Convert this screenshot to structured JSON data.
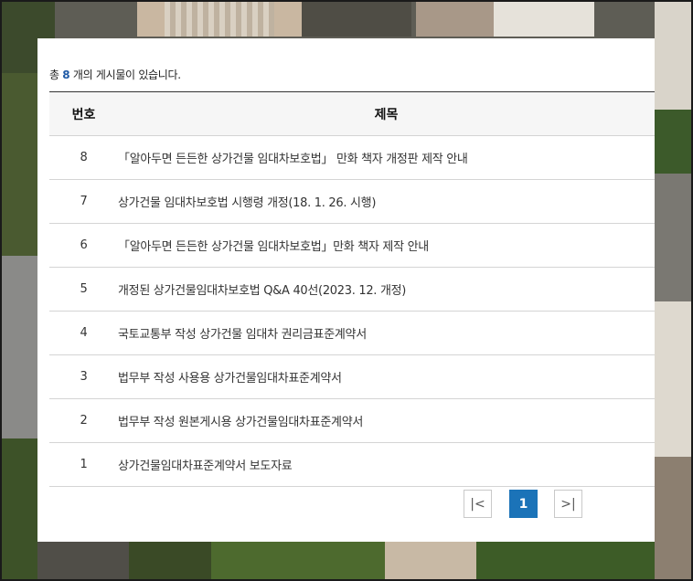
{
  "board": {
    "count_prefix": "총",
    "count": "8",
    "count_suffix": "개의 게시물이 있습니다."
  },
  "table": {
    "headers": [
      "번호",
      "제목"
    ],
    "rows": [
      {
        "num": "8",
        "title": "「알아두면 든든한 상가건물 임대차보호법」 만화 책자 개정판 제작 안내"
      },
      {
        "num": "7",
        "title": "상가건물 임대차보호법 시행령 개정(18. 1. 26. 시행)"
      },
      {
        "num": "6",
        "title": "「알아두면 든든한 상가건물 임대차보호법」만화 책자 제작 안내"
      },
      {
        "num": "5",
        "title": "개정된 상가건물임대차보호법 Q&A 40선(2023. 12. 개정)"
      },
      {
        "num": "4",
        "title": "국토교통부 작성 상가건물 임대차 권리금표준계약서"
      },
      {
        "num": "3",
        "title": "법무부 작성 사용용 상가건물임대차표준계약서"
      },
      {
        "num": "2",
        "title": "법무부 작성 원본게시용 상가건물임대차표준계약서"
      },
      {
        "num": "1",
        "title": "상가건물임대차표준계약서 보도자료"
      }
    ]
  },
  "pagination": {
    "first_icon": "first-page-icon",
    "first_glyph": "|<",
    "current_page": "1",
    "last_icon": "last-page-icon",
    "last_glyph": ">|"
  },
  "colors": {
    "accent": "#1b73b8",
    "count_highlight": "#1f5aa6"
  }
}
